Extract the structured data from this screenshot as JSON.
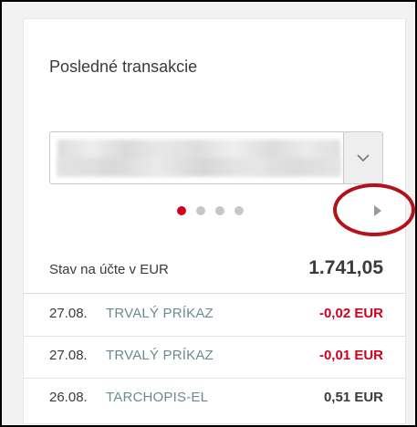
{
  "widget": {
    "title": "Posledné transakcie"
  },
  "account_select": {
    "value": "",
    "toggle_icon": "chevron-down-icon"
  },
  "pager": {
    "pages": 4,
    "active_index": 0,
    "next_icon": "triangle-right-icon"
  },
  "balance": {
    "label": "Stav na účte v EUR",
    "value": "1.741,05"
  },
  "transactions": [
    {
      "date": "27.08.",
      "description": "TRVALÝ PRÍKAZ",
      "amount": "-0,02 EUR",
      "type": "debit"
    },
    {
      "date": "27.08.",
      "description": "TRVALÝ PRÍKAZ",
      "amount": "-0,01 EUR",
      "type": "debit"
    },
    {
      "date": "26.08.",
      "description": "TARCHOPIS-EL",
      "amount": "0,51 EUR",
      "type": "credit"
    }
  ],
  "colors": {
    "accent": "#d1001f",
    "annotation": "#b3121b",
    "description": "#6b8a90",
    "text": "#3a3a3a"
  }
}
